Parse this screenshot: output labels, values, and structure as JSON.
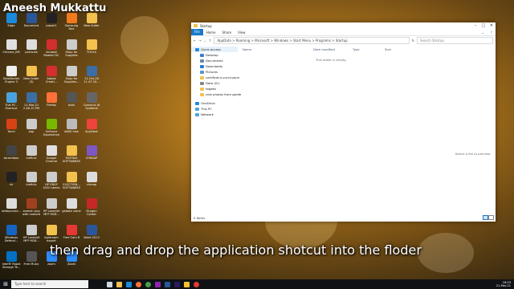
{
  "watermark": "Aneesh Mukkattu",
  "caption": "then drag and drop the application shotcut into the floder",
  "desktop_icons": [
    {
      "label": "Edge",
      "icon": "edge-icon",
      "color": "#1c8ad8"
    },
    {
      "label": "Document",
      "icon": "document-icon",
      "color": "#2b579a"
    },
    {
      "label": "power1",
      "icon": "app-icon",
      "color": "#222"
    },
    {
      "label": "Samsung Dex",
      "icon": "dex-icon",
      "color": "#f07a1d"
    },
    {
      "label": "New folder",
      "icon": "folder-icon",
      "color": "#f2c14e"
    },
    {
      "label": "Chrome_KM",
      "icon": "chrome-icon",
      "color": "#e0e0e0"
    },
    {
      "label": "particals",
      "icon": "file-icon",
      "color": "#ddd"
    },
    {
      "label": "Acrobat Reader DC",
      "icon": "acrobat-icon",
      "color": "#d32f2f"
    },
    {
      "label": "Shop for Supplies",
      "icon": "printer-icon",
      "color": "#ccc"
    },
    {
      "label": "TOOLS",
      "icon": "folder-icon",
      "color": "#f2c14e"
    },
    {
      "label": "SteelSeries Engine 3",
      "icon": "steelseries-icon",
      "color": "#eee"
    },
    {
      "label": "New folder (3)",
      "icon": "folder-icon",
      "color": "#f2c14e"
    },
    {
      "label": "Adobe Creati...",
      "icon": "adobe-icon",
      "color": "#d32f2f"
    },
    {
      "label": "Shop for Supplies...",
      "icon": "printer-icon",
      "color": "#ccc"
    },
    {
      "label": "11-Oct-20 11.47.10...",
      "icon": "image-icon",
      "color": "#3a6ea5"
    },
    {
      "label": "This PC - Shortcut",
      "icon": "pc-icon",
      "color": "#4aa3df"
    },
    {
      "label": "11-Mar-21 2.48.10 PM",
      "icon": "image-icon",
      "color": "#3a6ea5"
    },
    {
      "label": "Firefox",
      "icon": "firefox-icon",
      "color": "#ff7139"
    },
    {
      "label": "alvin",
      "icon": "app-icon",
      "color": "#555"
    },
    {
      "label": "Comunic Jit Systems",
      "icon": "app-icon",
      "color": "#666"
    },
    {
      "label": "Torch",
      "icon": "torch-icon",
      "color": "#d84315"
    },
    {
      "label": "eap",
      "icon": "file-icon",
      "color": "#ccc"
    },
    {
      "label": "GeForce Experience",
      "icon": "geforce-icon",
      "color": "#76b900"
    },
    {
      "label": "d600 hise",
      "icon": "file-icon",
      "color": "#bbb"
    },
    {
      "label": "AnyDesk",
      "icon": "anydesk-icon",
      "color": "#ef443b"
    },
    {
      "label": "torrentbox",
      "icon": "app-icon",
      "color": "#444"
    },
    {
      "label": "ineficla",
      "icon": "file-icon",
      "color": "#ccc"
    },
    {
      "label": "Google Chrome",
      "icon": "chrome-icon",
      "color": "#e0e0e0"
    },
    {
      "label": "EDITING SOFTWARES",
      "icon": "folder-icon",
      "color": "#f2c14e"
    },
    {
      "label": "CHKKAP",
      "icon": "app-icon",
      "color": "#7e57c2"
    },
    {
      "label": "nk",
      "icon": "app-icon",
      "color": "#222"
    },
    {
      "label": "ineficla",
      "icon": "file-icon",
      "color": "#ccc"
    },
    {
      "label": "HP ENVY 4520 series",
      "icon": "printer-icon",
      "color": "#ccc"
    },
    {
      "label": "ELECTION... SOFTWARES",
      "icon": "folder-icon",
      "color": "#f2c14e"
    },
    {
      "label": "chmap",
      "icon": "file-icon",
      "color": "#ddd"
    },
    {
      "label": "dotepcome...",
      "icon": "file-icon",
      "color": "#ddd"
    },
    {
      "label": "aneesh png with camera",
      "icon": "image-icon",
      "color": "#a04020"
    },
    {
      "label": "HP LaserJet MFP M28...",
      "icon": "printer-icon",
      "color": "#ccc"
    },
    {
      "label": "gabate vione",
      "icon": "file-icon",
      "color": "#ddd"
    },
    {
      "label": "Dragon Center",
      "icon": "dragon-icon",
      "color": "#c62828"
    },
    {
      "label": "Windows Defend...",
      "icon": "defender-icon",
      "color": "#1565c0"
    },
    {
      "label": "HP LaserJet MFP M28...",
      "icon": "printer-icon",
      "color": "#ccc"
    },
    {
      "label": "lightroom export",
      "icon": "folder-icon",
      "color": "#f2c14e"
    },
    {
      "label": "Free Cam 8",
      "icon": "app-icon",
      "color": "#e53935"
    },
    {
      "label": "Word 2013",
      "icon": "word-icon",
      "color": "#2b579a"
    },
    {
      "label": "Intel® Rapid Storage Te...",
      "icon": "intel-icon",
      "color": "#0071c5"
    },
    {
      "label": "Free Music",
      "icon": "music-icon",
      "color": "#555"
    },
    {
      "label": "zoom",
      "icon": "zoom-icon",
      "color": "#2d8cff"
    },
    {
      "label": "Zoom",
      "icon": "zoom-icon",
      "color": "#2d8cff"
    }
  ],
  "explorer": {
    "title": "Startup",
    "ribbon": {
      "file": "File",
      "home": "Home",
      "share": "Share",
      "view": "View"
    },
    "address": "AppData  >  Roaming  >  Microsoft  >  Windows  >  Start Menu  >  Programs  >  Startup",
    "search_placeholder": "Search Startup",
    "nav": [
      {
        "label": "Quick access",
        "color": "#1e88e5"
      },
      {
        "label": "Desktop",
        "color": "#3b7dd8"
      },
      {
        "label": "Documents",
        "color": "#6a89a8"
      },
      {
        "label": "Downloads",
        "color": "#2a7ad6"
      },
      {
        "label": "Pictures",
        "color": "#5a93c9"
      },
      {
        "label": "certificat-e-curriculum",
        "color": "#f2c14e"
      },
      {
        "label": "Data (D:)",
        "color": "#888"
      },
      {
        "label": "tagebs",
        "color": "#f2c14e"
      },
      {
        "label": "new photos from garde",
        "color": "#f2c14e"
      },
      {
        "label": "OneDrive",
        "color": "#1e88e5"
      },
      {
        "label": "This PC",
        "color": "#4aa3df"
      },
      {
        "label": "Network",
        "color": "#4aa3df"
      }
    ],
    "columns": [
      "Name",
      "Date modified",
      "Type",
      "Size"
    ],
    "empty_text": "This folder is empty.",
    "preview_text": "Select a file to preview.",
    "status": "0 items"
  },
  "taskbar": {
    "search_placeholder": "Type here to search",
    "apps": [
      {
        "icon": "task-view-icon",
        "color": "#cfd8dc"
      },
      {
        "icon": "explorer-icon",
        "color": "#f2c14e"
      },
      {
        "icon": "edge-icon",
        "color": "#1c8ad8"
      },
      {
        "icon": "firefox-icon",
        "color": "#ff7139"
      },
      {
        "icon": "chrome-icon",
        "color": "#43a047"
      },
      {
        "icon": "photos-icon",
        "color": "#8e24aa"
      },
      {
        "icon": "word-icon",
        "color": "#2b579a"
      },
      {
        "icon": "premiere-icon",
        "color": "#2a1a5e"
      },
      {
        "icon": "app-icon",
        "color": "#fbc02d"
      },
      {
        "icon": "record-icon",
        "color": "#e53935"
      }
    ],
    "time": "18:03",
    "date": "21-Mar-21"
  }
}
